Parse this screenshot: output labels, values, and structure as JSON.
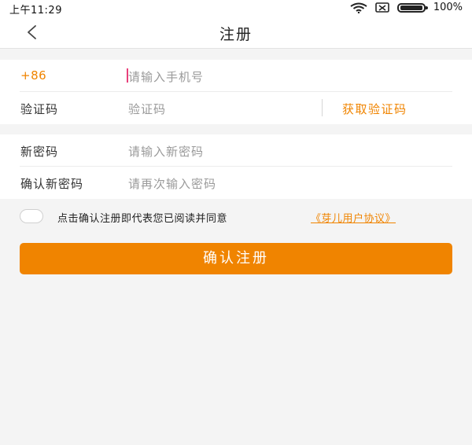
{
  "status_bar": {
    "time": "上午11:29",
    "battery": "100%",
    "icons": [
      "wifi-icon",
      "sim-card-icon",
      "battery-icon"
    ]
  },
  "nav": {
    "back_icon": "chevron-left-icon",
    "title": "注册"
  },
  "form": {
    "phone": {
      "prefix": "+86",
      "placeholder": "请输入手机号"
    },
    "code": {
      "label": "验证码",
      "placeholder": "验证码",
      "get_code": "获取验证码"
    },
    "new_password": {
      "label": "新密码",
      "placeholder": "请输入新密码"
    },
    "confirm_password": {
      "label": "确认新密码",
      "placeholder": "请再次输入密码"
    }
  },
  "agreement": {
    "text": "点击确认注册即代表您已阅读并同意",
    "link": "《芽儿用户协议》",
    "checked": false
  },
  "submit": {
    "label": "确认注册"
  },
  "colors": {
    "accent": "#f08400",
    "background": "#f4f4f4",
    "caret": "#e8407a"
  }
}
